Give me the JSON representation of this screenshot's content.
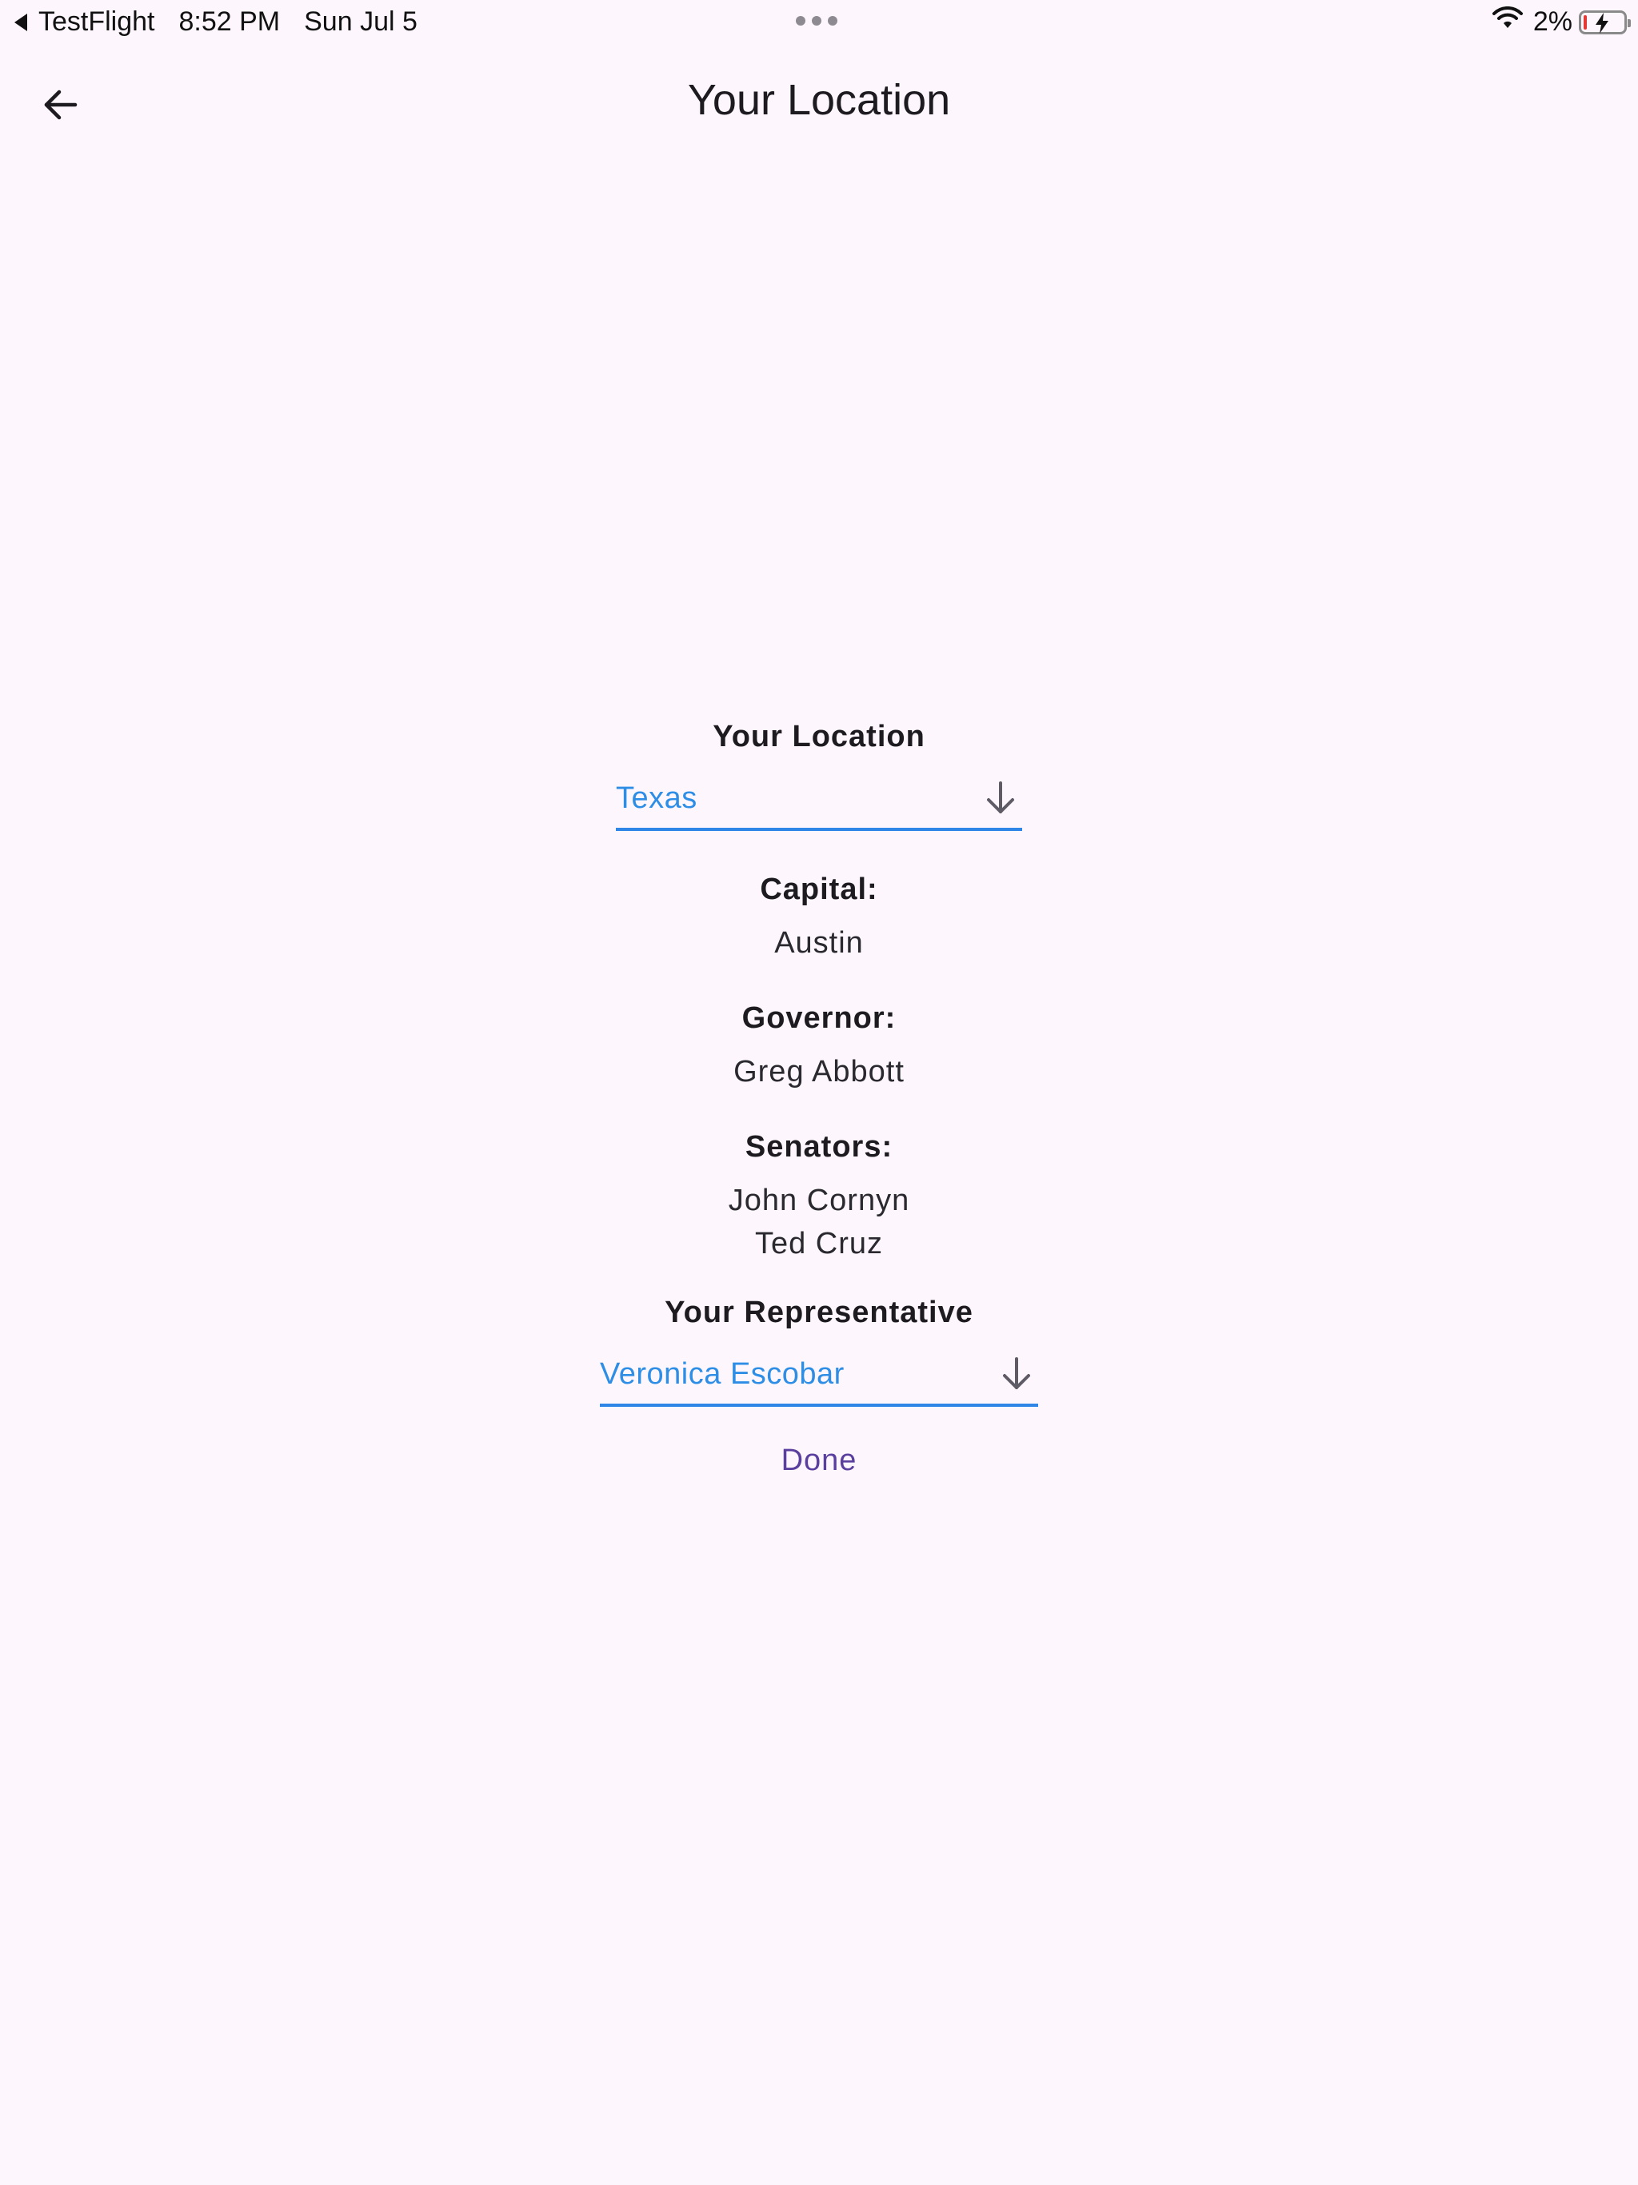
{
  "status_bar": {
    "back_app": "TestFlight",
    "time": "8:52 PM",
    "date": "Sun Jul 5",
    "battery_percent_text": "2%",
    "battery_level": 0.02,
    "icons": [
      "back-triangle-icon",
      "multitask-dots-icon",
      "wifi-icon",
      "battery-charging-icon"
    ]
  },
  "app_bar": {
    "title": "Your Location",
    "back_icon": "arrow-left-icon"
  },
  "location": {
    "heading": "Your Location",
    "selected_state": "Texas",
    "dropdown_icon": "arrow-down-icon"
  },
  "capital": {
    "heading": "Capital:",
    "value": "Austin"
  },
  "governor": {
    "heading": "Governor:",
    "value": "Greg Abbott"
  },
  "senators": {
    "heading": "Senators:",
    "names": [
      "John Cornyn",
      "Ted Cruz"
    ]
  },
  "representative": {
    "heading": "Your Representative",
    "selected": "Veronica Escobar",
    "dropdown_icon": "arrow-down-icon"
  },
  "actions": {
    "done_label": "Done"
  },
  "colors": {
    "background": "#fdf7fd",
    "accent_blue": "#2e8ee6",
    "underline_blue": "#2f86e6",
    "done_purple": "#5b3f9e",
    "battery_red": "#e53935"
  }
}
